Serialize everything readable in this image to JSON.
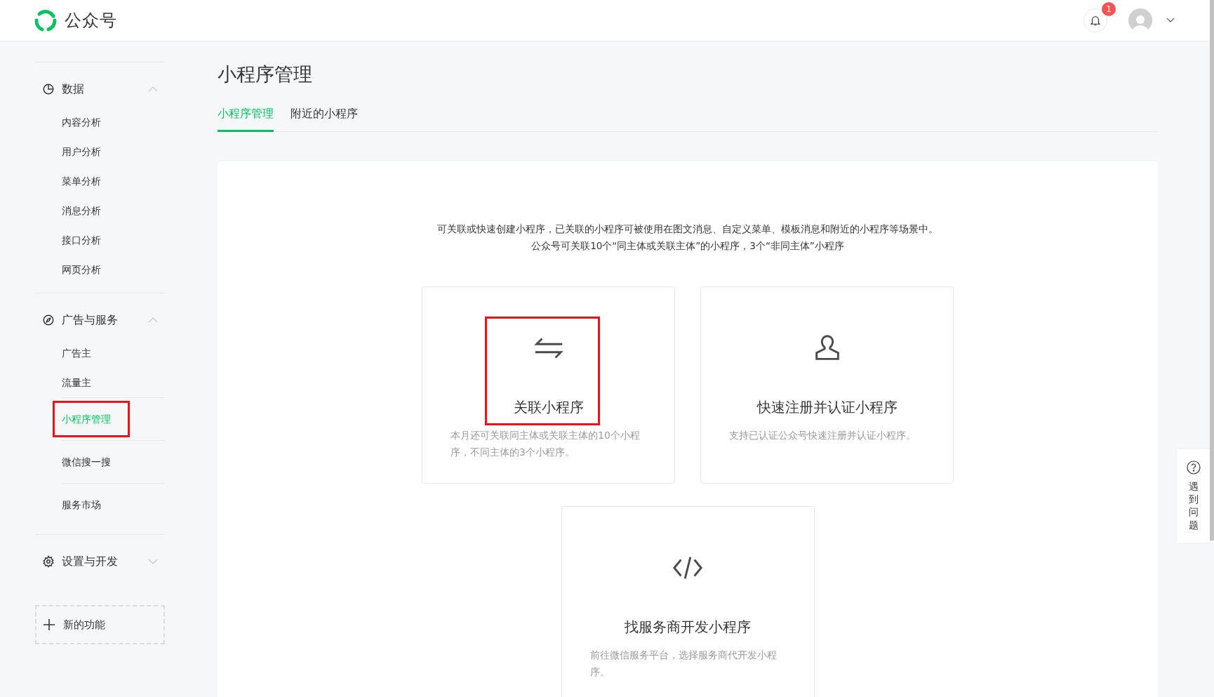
{
  "header": {
    "brand": "公众号",
    "notification_count": "1"
  },
  "sidebar": {
    "groups": [
      {
        "label": "数据",
        "expanded": true,
        "items": [
          {
            "label": "内容分析",
            "kind": "plain",
            "selected": false,
            "highlighted": false
          },
          {
            "label": "用户分析",
            "kind": "plain",
            "selected": false,
            "highlighted": false
          },
          {
            "label": "菜单分析",
            "kind": "plain",
            "selected": false,
            "highlighted": false
          },
          {
            "label": "消息分析",
            "kind": "plain",
            "selected": false,
            "highlighted": false
          },
          {
            "label": "接口分析",
            "kind": "plain",
            "selected": false,
            "highlighted": false
          },
          {
            "label": "网页分析",
            "kind": "plain",
            "selected": false,
            "highlighted": false
          }
        ]
      },
      {
        "label": "广告与服务",
        "expanded": true,
        "items": [
          {
            "label": "广告主",
            "kind": "plain",
            "selected": false,
            "highlighted": false
          },
          {
            "label": "流量主",
            "kind": "plain",
            "selected": false,
            "highlighted": false
          },
          {
            "label": "小程序管理",
            "kind": "divided",
            "selected": true,
            "highlighted": true
          },
          {
            "label": "微信搜一搜",
            "kind": "divided",
            "selected": false,
            "highlighted": false
          },
          {
            "label": "服务市场",
            "kind": "divided",
            "selected": false,
            "highlighted": false
          }
        ]
      },
      {
        "label": "设置与开发",
        "expanded": false
      }
    ],
    "new_feature": "新的功能"
  },
  "page": {
    "title": "小程序管理",
    "tabs": [
      {
        "label": "小程序管理",
        "selected": true
      },
      {
        "label": "附近的小程序",
        "selected": false
      }
    ],
    "intro": [
      "可关联或快速创建小程序，已关联的小程序可被使用在图文消息、自定义菜单、模板消息和附近的小程序等场景中。",
      "公众号可关联10个“同主体或关联主体”的小程序，3个“非同主体”小程序"
    ],
    "cards": [
      {
        "title": "关联小程序",
        "description": "本月还可关联同主体或关联主体的10个小程序，不同主体的3个小程序。",
        "highlighted": true
      },
      {
        "title": "快速注册并认证小程序",
        "description": "支持已认证公众号快速注册并认证小程序。",
        "highlighted": false
      },
      {
        "title": "找服务商开发小程序",
        "description": "前往微信服务平台，选择服务商代开发小程序。",
        "highlighted": false
      }
    ]
  },
  "help": {
    "label": "遇到问题"
  }
}
